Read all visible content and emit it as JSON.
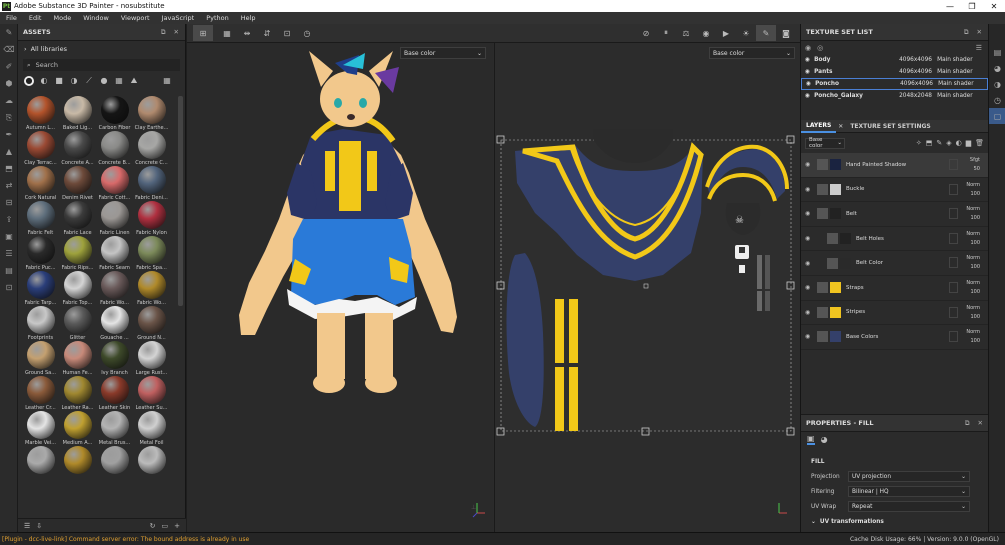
{
  "window": {
    "title": "Adobe Substance 3D Painter - nosubstitute",
    "logo": "Pt",
    "controls": [
      "—",
      "❐",
      "✕"
    ]
  },
  "menu": [
    "File",
    "Edit",
    "Mode",
    "Window",
    "Viewport",
    "JavaScript",
    "Python",
    "Help"
  ],
  "assets": {
    "title": "ASSETS",
    "library": "All libraries",
    "search_placeholder": "Search",
    "items": [
      {
        "label": "Autumn L...",
        "color": "#b3532b"
      },
      {
        "label": "Baked Lig...",
        "color": "#c8b9a6"
      },
      {
        "label": "Carbon Fiber",
        "color": "#151515"
      },
      {
        "label": "Clay Earthe...",
        "color": "#b08a6e"
      },
      {
        "label": "Clay Terrac...",
        "color": "#9b4a34"
      },
      {
        "label": "Concrete A...",
        "color": "#4a4a4a"
      },
      {
        "label": "Concrete B...",
        "color": "#8a8a88"
      },
      {
        "label": "Concrete C...",
        "color": "#a7a7a5"
      },
      {
        "label": "Cork Natural",
        "color": "#a0704a"
      },
      {
        "label": "Denim Rivet",
        "color": "#6d4a3a"
      },
      {
        "label": "Fabric Cott...",
        "color": "#d86a6a"
      },
      {
        "label": "Fabric Deni...",
        "color": "#52647c"
      },
      {
        "label": "Fabric Felt",
        "color": "#5e6e7c"
      },
      {
        "label": "Fabric Lace",
        "color": "#3b3b3b"
      },
      {
        "label": "Fabric Linen",
        "color": "#9b9794"
      },
      {
        "label": "Fabric Nylon",
        "color": "#b03040"
      },
      {
        "label": "Fabric Puc...",
        "color": "#2a2a2a"
      },
      {
        "label": "Fabric Rips...",
        "color": "#9ea23c"
      },
      {
        "label": "Fabric Seam",
        "color": "#c4c4c4"
      },
      {
        "label": "Fabric Spa...",
        "color": "#7c8a5a"
      },
      {
        "label": "Fabric Tarp...",
        "color": "#2a3e7a"
      },
      {
        "label": "Fabric Top...",
        "color": "#d4d4d4"
      },
      {
        "label": "Fabric Wo...",
        "color": "#6a5a5a"
      },
      {
        "label": "Fabric Wo...",
        "color": "#b08a2a"
      },
      {
        "label": "Footprints",
        "color": "#c8c8c8"
      },
      {
        "label": "Glitter",
        "color": "#5a5a5a"
      },
      {
        "label": "Gouache ...",
        "color": "#e4e4e4"
      },
      {
        "label": "Ground N...",
        "color": "#6a5448"
      },
      {
        "label": "Ground Sa...",
        "color": "#c4a070"
      },
      {
        "label": "Human Fe...",
        "color": "#c88a7a"
      },
      {
        "label": "Ivy Branch",
        "color": "#3e4a2a"
      },
      {
        "label": "Large Rust...",
        "color": "#d4d4d4"
      },
      {
        "label": "Leather Cr...",
        "color": "#8a5a3a"
      },
      {
        "label": "Leather Ra...",
        "color": "#a08830"
      },
      {
        "label": "Leather Skin",
        "color": "#8a3a2a"
      },
      {
        "label": "Leather Su...",
        "color": "#c06060"
      },
      {
        "label": "Marble Vei...",
        "color": "#e4e4e4"
      },
      {
        "label": "Medium A...",
        "color": "#c0a030"
      },
      {
        "label": "Metal Brus...",
        "color": "#b4b4b4"
      },
      {
        "label": "Metal Foil",
        "color": "#d0d0d0"
      },
      {
        "label": "",
        "color": "#aaaaaa"
      },
      {
        "label": "",
        "color": "#b08a2a"
      },
      {
        "label": "",
        "color": "#a0a0a0"
      },
      {
        "label": "",
        "color": "#bbbbbb"
      }
    ]
  },
  "viewport": {
    "channel_left": "Base color",
    "channel_right": "Base color"
  },
  "texture_set_list": {
    "title": "TEXTURE SET LIST",
    "rows": [
      {
        "name": "Body",
        "size": "4096x4096",
        "shader": "Main shader"
      },
      {
        "name": "Pants",
        "size": "4096x4096",
        "shader": "Main shader"
      },
      {
        "name": "Poncho",
        "size": "4096x4096",
        "shader": "Main shader"
      },
      {
        "name": "Poncho_Galaxy",
        "size": "2048x2048",
        "shader": "Main shader"
      }
    ]
  },
  "layers": {
    "tab_layers": "LAYERS",
    "tab_settings": "TEXTURE SET SETTINGS",
    "channel": "Base color",
    "rows": [
      {
        "name": "Hand Painted Shadow",
        "blend": "Sfgt",
        "opacity": "50",
        "color": "#1a2340"
      },
      {
        "name": "Buckle",
        "blend": "Norm",
        "opacity": "100",
        "color": "#cccccc"
      },
      {
        "name": "Belt",
        "blend": "Norm",
        "opacity": "100",
        "color": "#222222"
      },
      {
        "name": "Belt Holes",
        "blend": "Norm",
        "opacity": "100",
        "color": "#222222"
      },
      {
        "name": "Belt Color",
        "blend": "Norm",
        "opacity": "100",
        "color": "#2a2a2a"
      },
      {
        "name": "Straps",
        "blend": "Norm",
        "opacity": "100",
        "color": "#f0c420"
      },
      {
        "name": "Stripes",
        "blend": "Norm",
        "opacity": "100",
        "color": "#f0c420"
      },
      {
        "name": "Base Colors",
        "blend": "Norm",
        "opacity": "100",
        "color": "#34406a"
      }
    ]
  },
  "properties": {
    "title": "PROPERTIES - FILL",
    "section": "FILL",
    "projection_label": "Projection",
    "projection": "UV projection",
    "filtering_label": "Filtering",
    "filtering": "Bilinear | HQ",
    "uvwrap_label": "UV Wrap",
    "uvwrap": "Repeat",
    "uvtrans": "UV transformations"
  },
  "status": {
    "error": "[Plugin - dcc-live-link] Command server error: The bound address is already in use",
    "right": "Cache Disk Usage:    66%  |  Version: 9.0.0 (OpenGL)"
  }
}
